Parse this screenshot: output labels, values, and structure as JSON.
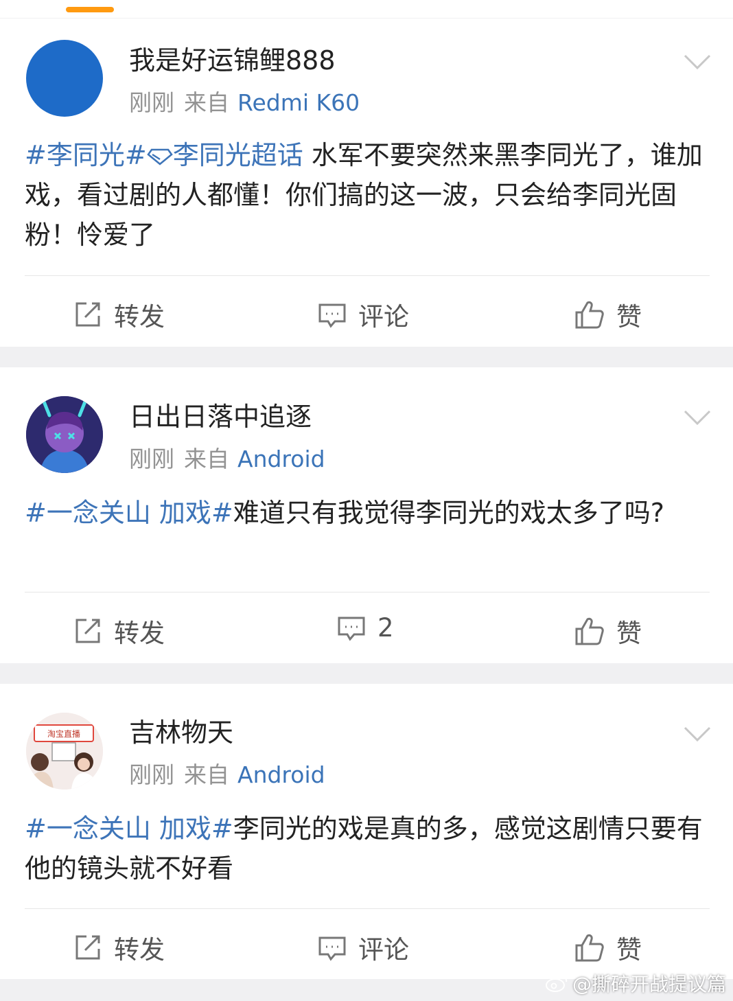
{
  "posts": [
    {
      "username": "我是好运锦鲤888",
      "time": "刚刚",
      "from": "来自",
      "device": "Redmi K60",
      "tag1": "#李同光#",
      "tag2": "李同光超话",
      "text": " 水军不要突然来黑李同光了，谁加戏，看过剧的人都懂！你们搞的这一波，只会给李同光固粉！怜爱了",
      "repost": "转发",
      "comment": "评论",
      "like": "赞"
    },
    {
      "username": "日出日落中追逐",
      "time": "刚刚",
      "from": "来自",
      "device": "Android",
      "tag1": "#一念关山 加戏#",
      "text": "难道只有我觉得李同光的戏太多了吗?",
      "repost": "转发",
      "comment": "2",
      "like": "赞"
    },
    {
      "username": "吉林物天",
      "time": "刚刚",
      "from": "来自",
      "device": "Android",
      "avatar_sign": "淘宝直播",
      "tag1": "#一念关山 加戏#",
      "text": "李同光的戏是真的多，感觉这剧情只要有他的镜头就不好看",
      "repost": "转发",
      "comment": "评论",
      "like": "赞"
    }
  ],
  "watermark": "@撕碎开战提议篇",
  "colors": {
    "accent": "#ff9a10",
    "link": "#3d74b8",
    "meta": "#939393"
  }
}
